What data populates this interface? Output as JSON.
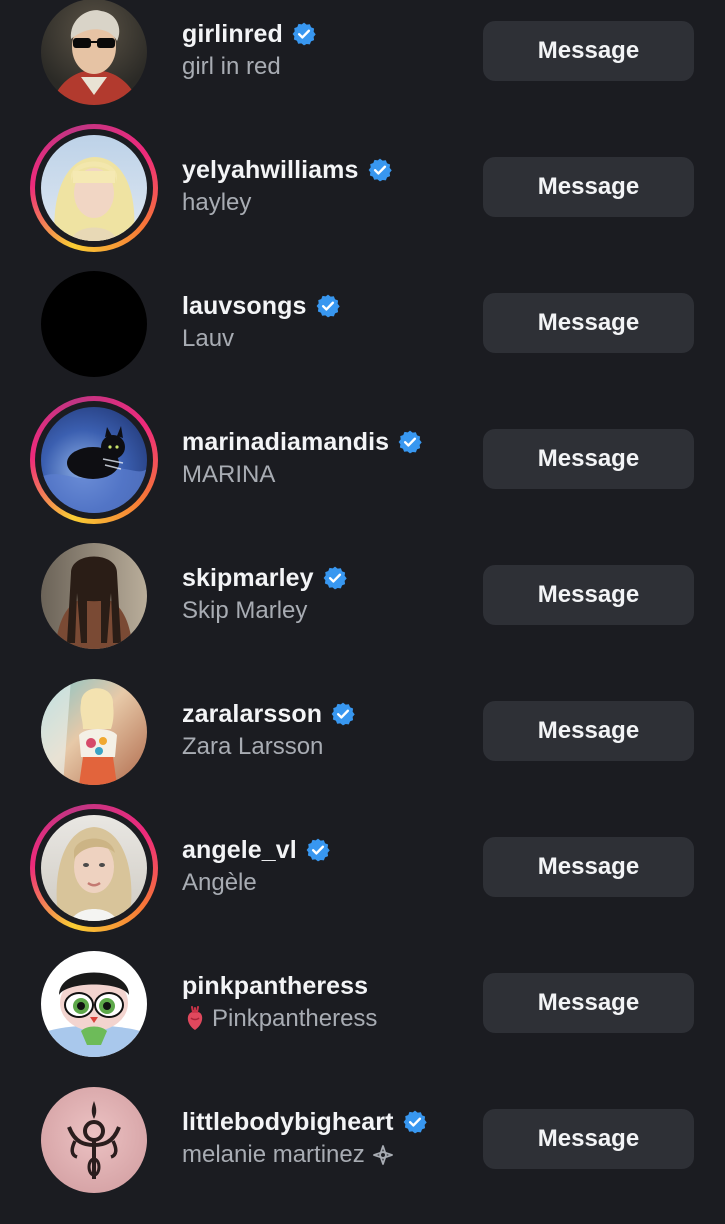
{
  "button_label": "Message",
  "accounts": [
    {
      "username": "girlinred",
      "full_name": "girl in red",
      "verified": true,
      "has_story": false,
      "avatar": "wolfgang-portrait-sunglasses"
    },
    {
      "username": "yelyahwilliams",
      "full_name": "hayley",
      "verified": true,
      "has_story": true,
      "avatar": "blonde-bangs-portrait"
    },
    {
      "username": "lauvsongs",
      "full_name": "Lauv",
      "verified": true,
      "has_story": false,
      "avatar": "black-circle"
    },
    {
      "username": "marinadiamandis",
      "full_name": "MARINA",
      "verified": true,
      "has_story": true,
      "avatar": "black-cat-on-blue-satin"
    },
    {
      "username": "skipmarley",
      "full_name": "Skip Marley",
      "verified": true,
      "has_story": false,
      "avatar": "dreadlocks-portrait"
    },
    {
      "username": "zaralarsson",
      "full_name": "Zara Larsson",
      "verified": true,
      "has_story": false,
      "avatar": "colorful-outfit-portrait"
    },
    {
      "username": "angele_vl",
      "full_name": "Angèle",
      "verified": true,
      "has_story": true,
      "avatar": "blonde-hair-portrait"
    },
    {
      "username": "pinkpantheress",
      "full_name": "Pinkpantheress",
      "full_name_prefix_icon": "anatomical-heart-icon",
      "verified": false,
      "has_story": false,
      "avatar": "cartoon-girl-big-eyes"
    },
    {
      "username": "littlebodybigheart",
      "full_name": "melanie martinez",
      "full_name_suffix_icon": "sparkle-diamond-icon",
      "verified": true,
      "has_story": false,
      "avatar": "pink-symbol-logo"
    }
  ],
  "colors": {
    "background": "#1b1c21",
    "button": "#2e3036",
    "verified_blue": "#3897f0",
    "secondary_text": "#a8acb3"
  }
}
